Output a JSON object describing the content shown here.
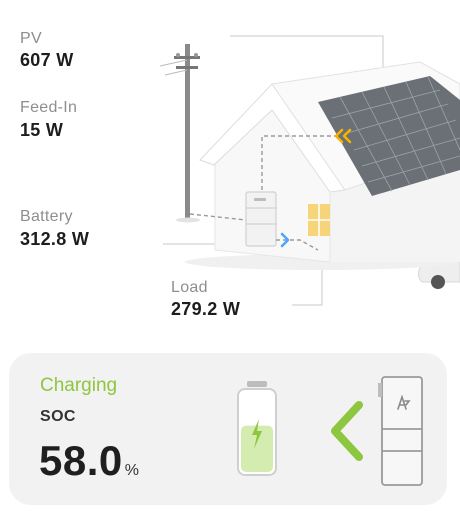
{
  "metrics": {
    "pv": {
      "label": "PV",
      "value": "607 W"
    },
    "feed_in": {
      "label": "Feed-In",
      "value": "15 W"
    },
    "battery": {
      "label": "Battery",
      "value": "312.8 W"
    },
    "load": {
      "label": "Load",
      "value": "279.2 W"
    }
  },
  "status_card": {
    "status": "Charging",
    "soc_label": "SOC",
    "soc_value": "58.0",
    "soc_unit": "%",
    "battery_level": 0.58
  },
  "colors": {
    "accent_green": "#8dc63f",
    "flow_arrow_orange": "#f4b400",
    "flow_arrow_blue": "#4da6ff"
  },
  "icons": {
    "battery": "battery-icon",
    "bolt": "lightning-bolt-icon",
    "arrow": "chevron-left-arrow-icon",
    "inverter": "inverter-device-icon"
  }
}
